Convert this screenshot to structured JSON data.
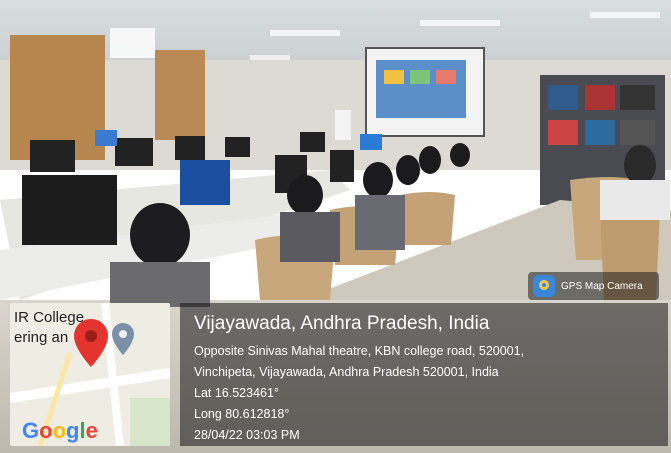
{
  "badge": {
    "label": "GPS Map Camera"
  },
  "map": {
    "line1": "IR College",
    "line2": "ering an",
    "brand": "Google"
  },
  "location": {
    "title": "Vijayawada, Andhra Pradesh, India",
    "address1": "Opposite Sinivas Mahal theatre, KBN college road, 520001,",
    "address2": "Vinchipeta, Vijayawada, Andhra Pradesh 520001, India",
    "lat": "Lat 16.523461°",
    "long": "Long 80.612818°",
    "timestamp": "28/04/22 03:03 PM"
  }
}
